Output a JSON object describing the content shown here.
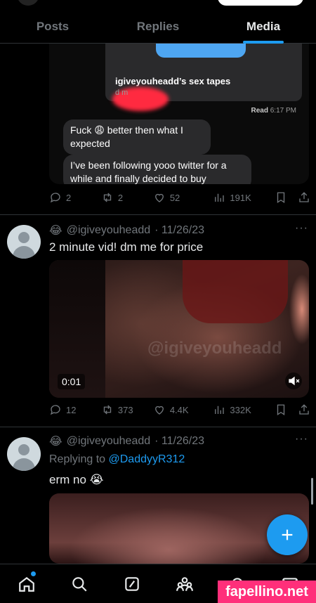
{
  "tabs": [
    {
      "label": "Posts",
      "active": false
    },
    {
      "label": "Replies",
      "active": false
    },
    {
      "label": "Media",
      "active": true
    }
  ],
  "post1": {
    "screenshot": {
      "card_title": "igiveyouheadd’s sex tapes",
      "card_sub": "d        m",
      "read_label": "Read",
      "read_time": "6:17 PM",
      "message1": "Fuck 😩 better then what I expected",
      "message2": "I’ve been following yooo twitter for a while and finally decided to buy"
    },
    "actions": {
      "replies": "2",
      "reposts": "2",
      "likes": "52",
      "views": "191K"
    }
  },
  "post2": {
    "emoji": "😂",
    "handle": "@igiveyouheadd",
    "date": "· 11/26/23",
    "more": "···",
    "text": "2 minute vid! dm me for price",
    "video": {
      "duration": "0:01",
      "watermark": "@igiveyouheadd"
    },
    "actions": {
      "replies": "12",
      "reposts": "373",
      "likes": "4.4K",
      "views": "332K"
    }
  },
  "post3": {
    "emoji": "😂",
    "handle": "@igiveyouheadd",
    "date": "· 11/26/23",
    "more": "···",
    "replying_to_label": "Replying to",
    "replying_to_user": "@DaddyyR312",
    "text": "erm no 😭"
  },
  "fab": {
    "icon": "plus-icon"
  },
  "navbar": {
    "items": [
      "home-icon",
      "search-icon",
      "compose-icon",
      "communities-icon",
      "notifications-icon",
      "messages-icon"
    ]
  },
  "watermark": "fapellino.net",
  "colors": {
    "accent": "#1d9bf0",
    "background": "#000000",
    "muted": "#71767b",
    "watermark": "#ff2f7a"
  }
}
